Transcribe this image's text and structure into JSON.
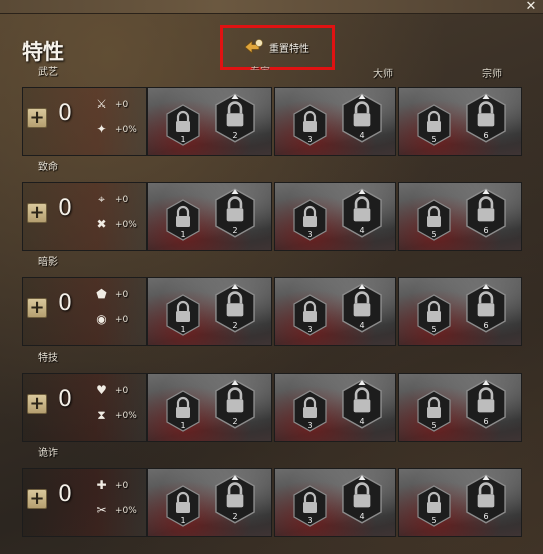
{
  "window": {
    "title": "特性",
    "close_glyph": "✕",
    "reset_label": "重置特性",
    "highlight_color": "#e01212"
  },
  "tiers": {
    "adept": "专家",
    "master": "大师",
    "grandmaster": "宗师"
  },
  "icons": {
    "close": "close-icon",
    "reset": "reset-arrow-icon",
    "plus": "plus-icon",
    "lock": "lock-icon"
  },
  "trait_lines": [
    {
      "name": "武艺",
      "points": "0",
      "plus": "+",
      "attributes": [
        {
          "icon": "sword-icon",
          "glyph": "⚔",
          "value": "+0"
        },
        {
          "icon": "crit-damage-icon",
          "glyph": "✦",
          "value": "+0%"
        }
      ],
      "traits": [
        "1",
        "2",
        "3",
        "4",
        "5",
        "6"
      ]
    },
    {
      "name": "致命",
      "points": "0",
      "plus": "+",
      "attributes": [
        {
          "icon": "crosshair-icon",
          "glyph": "⌖",
          "value": "+0"
        },
        {
          "icon": "condition-damage-icon",
          "glyph": "✖",
          "value": "+0%"
        }
      ],
      "traits": [
        "1",
        "2",
        "3",
        "4",
        "5",
        "6"
      ]
    },
    {
      "name": "暗影",
      "points": "0",
      "plus": "+",
      "attributes": [
        {
          "icon": "shield-icon",
          "glyph": "⬟",
          "value": "+0"
        },
        {
          "icon": "boon-duration-icon",
          "glyph": "◉",
          "value": "+0"
        }
      ],
      "traits": [
        "1",
        "2",
        "3",
        "4",
        "5",
        "6"
      ]
    },
    {
      "name": "特技",
      "points": "0",
      "plus": "+",
      "attributes": [
        {
          "icon": "heart-icon",
          "glyph": "♥",
          "value": "+0"
        },
        {
          "icon": "hourglass-icon",
          "glyph": "⧗",
          "value": "+0%"
        }
      ],
      "traits": [
        "1",
        "2",
        "3",
        "4",
        "5",
        "6"
      ]
    },
    {
      "name": "诡诈",
      "points": "0",
      "plus": "+",
      "attributes": [
        {
          "icon": "precision-icon",
          "glyph": "✚",
          "value": "+0"
        },
        {
          "icon": "scissors-icon",
          "glyph": "✂",
          "value": "+0%"
        }
      ],
      "traits": [
        "1",
        "2",
        "3",
        "4",
        "5",
        "6"
      ]
    }
  ]
}
